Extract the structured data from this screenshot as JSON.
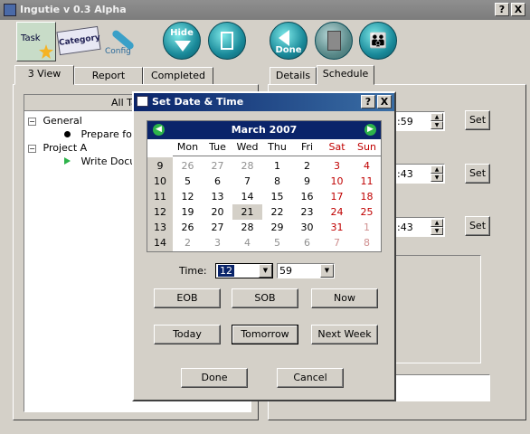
{
  "window": {
    "title": "Ingutie v 0.3 Alpha",
    "help": "?",
    "close": "X"
  },
  "toolbar": [
    {
      "label": "Task",
      "icon": "task-icon"
    },
    {
      "label": "Category",
      "icon": "category-icon"
    },
    {
      "label": "Config",
      "icon": "config-icon"
    },
    {
      "label": "Hide",
      "icon": "hide-icon"
    },
    {
      "label": "",
      "icon": "info-icon"
    },
    {
      "label": "Done",
      "icon": "done-icon"
    },
    {
      "label": "",
      "icon": "trash-icon"
    },
    {
      "label": "",
      "icon": "people-icon"
    }
  ],
  "left_tabs": [
    "3 View",
    "Report",
    "Completed"
  ],
  "tree": {
    "header": "All Ta",
    "items": [
      {
        "label": "General"
      },
      {
        "label": "Prepare for"
      },
      {
        "label": "Project A"
      },
      {
        "label": "Write Docu"
      }
    ]
  },
  "right_tabs": [
    "Details",
    "Schedule"
  ],
  "schedule_rows": [
    {
      "value": ":59",
      "set": "Set"
    },
    {
      "value": ":43",
      "set": "Set"
    },
    {
      "value": ":43",
      "set": "Set"
    }
  ],
  "dialog": {
    "title": "Set Date & Time",
    "help": "?",
    "close": "X",
    "month": "March  2007",
    "weekdays": [
      "Mon",
      "Tue",
      "Wed",
      "Thu",
      "Fri",
      "Sat",
      "Sun"
    ],
    "weeks": [
      {
        "wk": "9",
        "days": [
          "26",
          "27",
          "28",
          "1",
          "2",
          "3",
          "4"
        ]
      },
      {
        "wk": "10",
        "days": [
          "5",
          "6",
          "7",
          "8",
          "9",
          "10",
          "11"
        ]
      },
      {
        "wk": "11",
        "days": [
          "12",
          "13",
          "14",
          "15",
          "16",
          "17",
          "18"
        ]
      },
      {
        "wk": "12",
        "days": [
          "19",
          "20",
          "21",
          "22",
          "23",
          "24",
          "25"
        ]
      },
      {
        "wk": "13",
        "days": [
          "26",
          "27",
          "28",
          "29",
          "30",
          "31",
          "1"
        ]
      },
      {
        "wk": "14",
        "days": [
          "2",
          "3",
          "4",
          "5",
          "6",
          "7",
          "8"
        ]
      }
    ],
    "selected_day": "21",
    "time_label": "Time:",
    "hour": "12",
    "minute": "59",
    "buttons_row1": [
      "EOB",
      "SOB",
      "Now"
    ],
    "buttons_row2": [
      "Today",
      "Tomorrow",
      "Next Week"
    ],
    "done": "Done",
    "cancel": "Cancel"
  }
}
